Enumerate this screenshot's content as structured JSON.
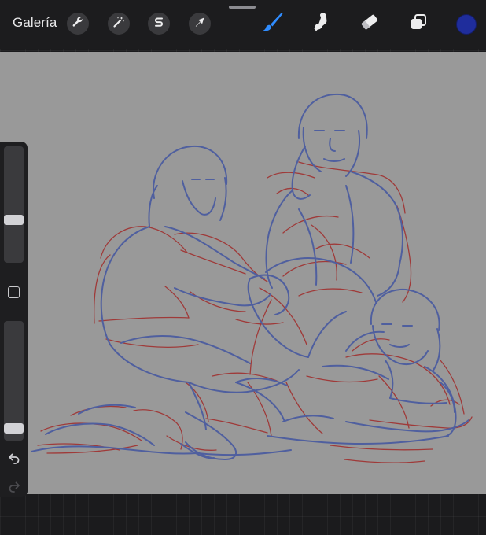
{
  "topbar": {
    "gallery_label": "Galería",
    "actions_icons": [
      "wrench-icon",
      "magic-wand-icon",
      "selection-s-icon",
      "transform-arrow-icon"
    ],
    "tools_icons": [
      "brush-icon",
      "smudge-icon",
      "eraser-icon",
      "layers-icon"
    ],
    "active_tool": "brush",
    "current_color": "#1f2d9c",
    "active_tool_color": "#2f8cff"
  },
  "sidebar": {
    "brush_size_level": 0.35,
    "brush_opacity_level": 0.05,
    "icons": [
      "modify-square-icon",
      "undo-icon",
      "redo-icon"
    ]
  },
  "canvas": {
    "background": "#999999",
    "sketch_colors": {
      "blue": "#4f5f9f",
      "red": "#a0302f"
    }
  }
}
